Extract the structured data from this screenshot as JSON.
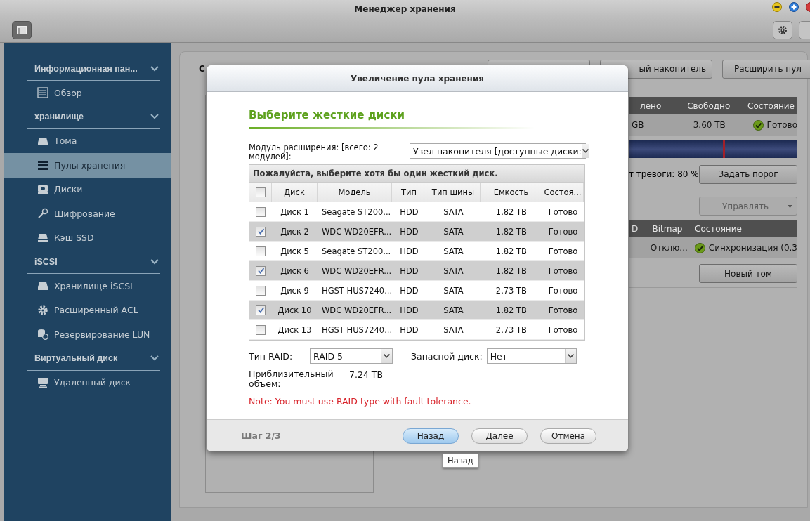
{
  "window": {
    "title": "Менеджер хранения"
  },
  "sidebar": {
    "groups": [
      {
        "label": "Информационная пан...",
        "expanded": true,
        "items": [
          {
            "label": "Обзор",
            "kind": "overview",
            "selected": false
          }
        ]
      },
      {
        "label": "хранилище",
        "expanded": true,
        "items": [
          {
            "label": "Тома",
            "kind": "volume",
            "selected": false
          },
          {
            "label": "Пулы хранения",
            "kind": "pool",
            "selected": true
          },
          {
            "label": "Диски",
            "kind": "disk",
            "selected": false
          },
          {
            "label": "Шифрование",
            "kind": "key",
            "selected": false
          },
          {
            "label": "Кэш SSD",
            "kind": "ssd",
            "selected": false
          }
        ]
      },
      {
        "label": "iSCSI",
        "expanded": true,
        "items": [
          {
            "label": "Хранилище iSCSI",
            "kind": "volume",
            "selected": false
          },
          {
            "label": "Расширенный ACL",
            "kind": "gear",
            "selected": false
          },
          {
            "label": "Резервирование LUN",
            "kind": "lun",
            "selected": false
          }
        ]
      },
      {
        "label": "Виртуальный диск",
        "expanded": true,
        "items": [
          {
            "label": "Удаленный диск",
            "kind": "remote",
            "selected": false
          }
        ]
      }
    ]
  },
  "main": {
    "tab": "С",
    "buttons": [
      {
        "kind": "blank"
      },
      {
        "kind": "text",
        "label": "ый накопитель"
      },
      {
        "kind": "text",
        "label": "Расширить пул"
      }
    ],
    "pool_table": {
      "columns": [
        "лено",
        "Свободно",
        "Состояние"
      ],
      "row": {
        "cells": [
          "GB",
          "3.60 TB"
        ],
        "status": "Готово"
      }
    },
    "alert": {
      "text": "т тревоги: 80 %",
      "button": "Задать порог"
    },
    "manage": {
      "label": "Управлять",
      "disabled": true
    },
    "volume_table": {
      "columns": [
        "D",
        "Bitmap",
        "Состояние"
      ],
      "row": {
        "cells": [
          "Отклю..."
        ],
        "status": "Синхронизация (0.3"
      }
    },
    "new_volume_button": "Новый том"
  },
  "dialog": {
    "title": "Увеличение пула хранения",
    "heading": "Выберите жесткие диски",
    "module_label": "Модуль расширения: [всего: 2 модулей]:",
    "module_value": "Узел накопителя [доступные диски:",
    "table": {
      "caption": "Пожалуйста, выберите хотя бы один жесткий диск.",
      "all_checked": false,
      "columns": [
        "Диск",
        "Модель",
        "Тип",
        "Тип шины",
        "Емкость",
        "Состоя..."
      ],
      "rows": [
        {
          "checked": false,
          "cells": [
            "Диск 1",
            "Seagate ST200...",
            "HDD",
            "SATA",
            "1.82 TB",
            "Готово"
          ]
        },
        {
          "checked": true,
          "cells": [
            "Диск 2",
            "WDC WD20EFR...",
            "HDD",
            "SATA",
            "1.82 TB",
            "Готово"
          ]
        },
        {
          "checked": false,
          "cells": [
            "Диск 5",
            "Seagate ST200...",
            "HDD",
            "SATA",
            "1.82 TB",
            "Готово"
          ]
        },
        {
          "checked": true,
          "cells": [
            "Диск 6",
            "WDC WD20EFR...",
            "HDD",
            "SATA",
            "1.82 TB",
            "Готово"
          ]
        },
        {
          "checked": false,
          "cells": [
            "Диск 9",
            "HGST HUS7240...",
            "HDD",
            "SATA",
            "2.73 TB",
            "Готово"
          ]
        },
        {
          "checked": true,
          "cells": [
            "Диск 10",
            "WDC WD20EFR...",
            "HDD",
            "SATA",
            "1.82 TB",
            "Готово"
          ]
        },
        {
          "checked": false,
          "cells": [
            "Диск 13",
            "HGST HUS7240...",
            "HDD",
            "SATA",
            "2.73 TB",
            "Готово"
          ]
        }
      ]
    },
    "raid_label": "Тип RAID:",
    "raid_value": "RAID 5",
    "spare_label": "Запасной диск:",
    "spare_value": "Нет",
    "capacity_label": "Приблизительный объем:",
    "capacity_value": "7.24 TB",
    "note": "Note: You must use RAID type with fault tolerance.",
    "step": "Шаг 2/3",
    "buttons": [
      {
        "label": "Назад",
        "focused": true
      },
      {
        "label": "Далее",
        "focused": false
      },
      {
        "label": "Отмена",
        "focused": false
      }
    ],
    "tooltip": "Назад"
  }
}
